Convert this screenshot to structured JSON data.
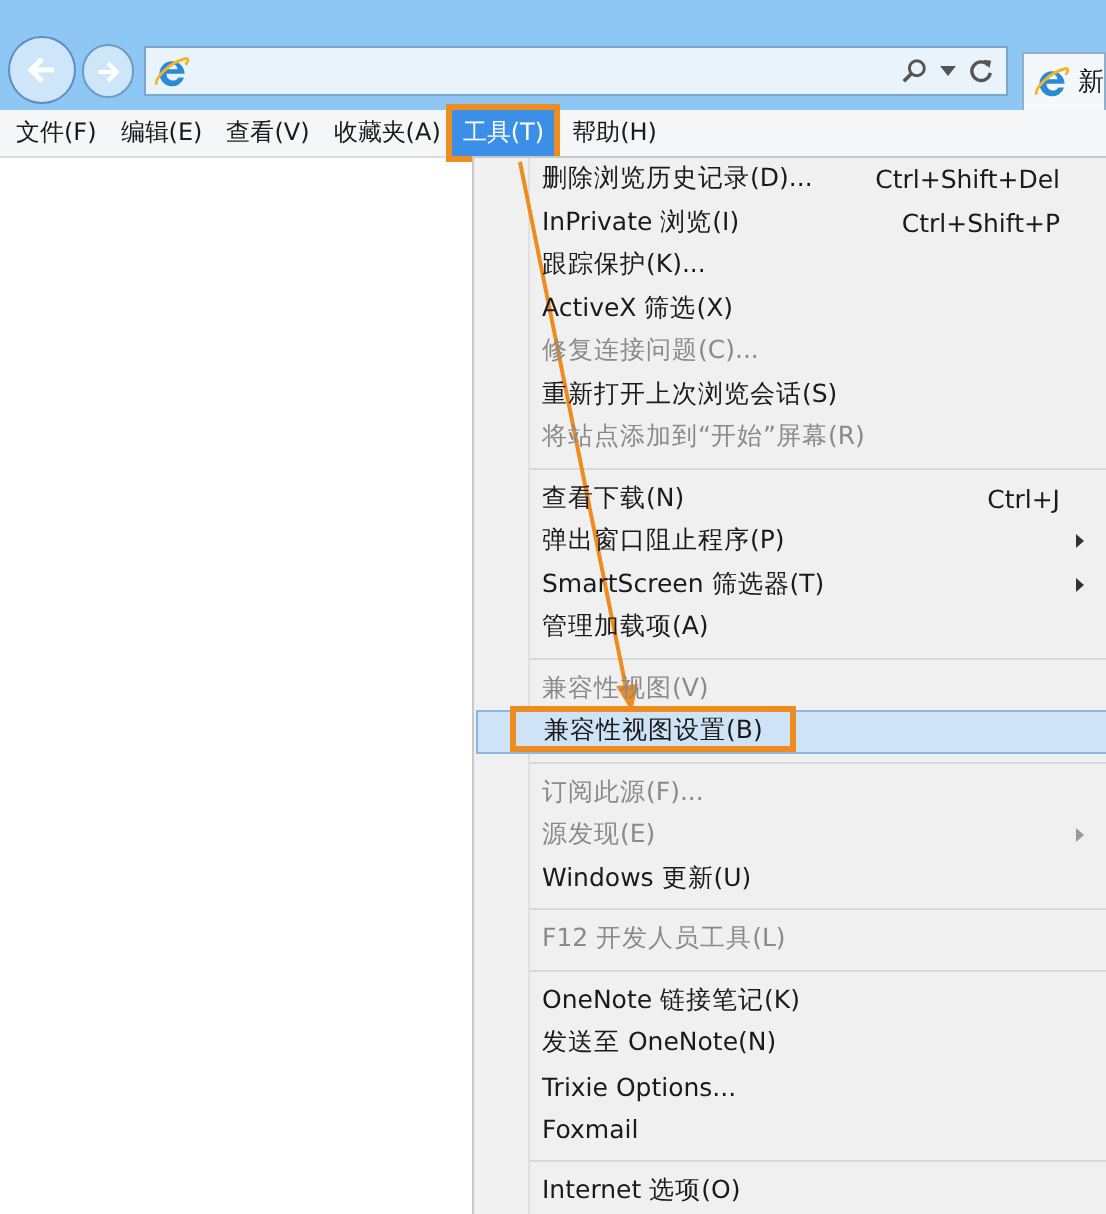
{
  "menu_bar": [
    {
      "label": "文件(F)",
      "selected": false,
      "callout": false
    },
    {
      "label": "编辑(E)",
      "selected": false,
      "callout": false
    },
    {
      "label": "查看(V)",
      "selected": false,
      "callout": false
    },
    {
      "label": "收藏夹(A)",
      "selected": false,
      "callout": false
    },
    {
      "label": "工具(T)",
      "selected": true,
      "callout": true
    },
    {
      "label": "帮助(H)",
      "selected": false,
      "callout": false
    }
  ],
  "tab": {
    "label": "新"
  },
  "tools_menu": [
    {
      "kind": "item",
      "label": "删除浏览历史记录(D)...",
      "shortcut": "Ctrl+Shift+Del",
      "disabled": false,
      "submenu": false,
      "selected": false,
      "callout": false
    },
    {
      "kind": "item",
      "label": "InPrivate 浏览(I)",
      "shortcut": "Ctrl+Shift+P",
      "disabled": false,
      "submenu": false,
      "selected": false,
      "callout": false
    },
    {
      "kind": "item",
      "label": "跟踪保护(K)...",
      "disabled": false,
      "submenu": false,
      "selected": false,
      "callout": false
    },
    {
      "kind": "item",
      "label": "ActiveX 筛选(X)",
      "disabled": false,
      "submenu": false,
      "selected": false,
      "callout": false
    },
    {
      "kind": "item",
      "label": "修复连接问题(C)...",
      "disabled": true,
      "submenu": false,
      "selected": false,
      "callout": false
    },
    {
      "kind": "item",
      "label": "重新打开上次浏览会话(S)",
      "disabled": false,
      "submenu": false,
      "selected": false,
      "callout": false
    },
    {
      "kind": "item",
      "label": "将站点添加到“开始”屏幕(R)",
      "disabled": true,
      "submenu": false,
      "selected": false,
      "callout": false
    },
    {
      "kind": "separator"
    },
    {
      "kind": "item",
      "label": "查看下载(N)",
      "shortcut": "Ctrl+J",
      "disabled": false,
      "submenu": false,
      "selected": false,
      "callout": false
    },
    {
      "kind": "item",
      "label": "弹出窗口阻止程序(P)",
      "disabled": false,
      "submenu": true,
      "selected": false,
      "callout": false
    },
    {
      "kind": "item",
      "label": "SmartScreen 筛选器(T)",
      "disabled": false,
      "submenu": true,
      "selected": false,
      "callout": false
    },
    {
      "kind": "item",
      "label": "管理加载项(A)",
      "disabled": false,
      "submenu": false,
      "selected": false,
      "callout": false
    },
    {
      "kind": "separator"
    },
    {
      "kind": "item",
      "label": "兼容性视图(V)",
      "disabled": true,
      "submenu": false,
      "selected": false,
      "callout": false
    },
    {
      "kind": "item",
      "label": "兼容性视图设置(B)",
      "disabled": false,
      "submenu": false,
      "selected": true,
      "callout": true
    },
    {
      "kind": "separator"
    },
    {
      "kind": "item",
      "label": "订阅此源(F)...",
      "disabled": true,
      "submenu": false,
      "selected": false,
      "callout": false
    },
    {
      "kind": "item",
      "label": "源发现(E)",
      "disabled": true,
      "submenu": true,
      "selected": false,
      "callout": false
    },
    {
      "kind": "item",
      "label": "Windows 更新(U)",
      "disabled": false,
      "submenu": false,
      "selected": false,
      "callout": false
    },
    {
      "kind": "separator"
    },
    {
      "kind": "item",
      "label": "F12 开发人员工具(L)",
      "disabled": true,
      "submenu": false,
      "selected": false,
      "callout": false
    },
    {
      "kind": "separator"
    },
    {
      "kind": "item",
      "label": "OneNote 链接笔记(K)",
      "disabled": false,
      "submenu": false,
      "selected": false,
      "callout": false
    },
    {
      "kind": "item",
      "label": "发送至 OneNote(N)",
      "disabled": false,
      "submenu": false,
      "selected": false,
      "callout": false
    },
    {
      "kind": "item",
      "label": "Trixie Options...",
      "disabled": false,
      "submenu": false,
      "selected": false,
      "callout": false
    },
    {
      "kind": "item",
      "label": "Foxmail",
      "disabled": false,
      "submenu": false,
      "selected": false,
      "callout": false
    },
    {
      "kind": "separator"
    },
    {
      "kind": "item",
      "label": "Internet 选项(O)",
      "disabled": false,
      "submenu": false,
      "selected": false,
      "callout": false
    }
  ]
}
